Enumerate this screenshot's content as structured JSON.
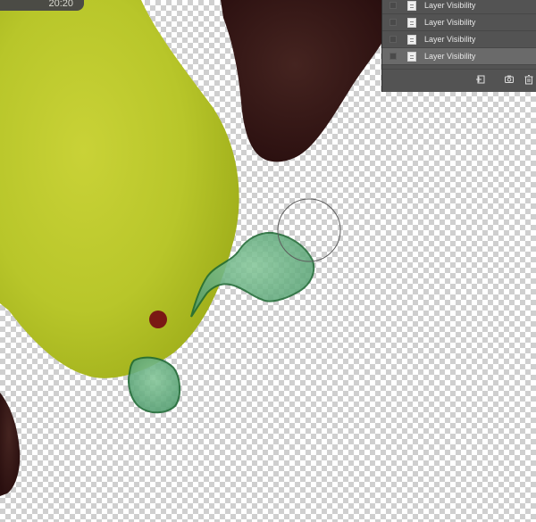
{
  "top_pill": {
    "text": "20:20"
  },
  "history_panel": {
    "rows": [
      {
        "label": "Layer Visibility"
      },
      {
        "label": "Layer Visibility"
      },
      {
        "label": "Layer Visibility"
      },
      {
        "label": "Layer Visibility"
      }
    ],
    "selected_index": 3,
    "footer_icons": [
      "new-snapshot-icon",
      "camera-icon",
      "trash-icon"
    ]
  },
  "colors": {
    "transparency_check_light": "#ffffff",
    "transparency_check_dark": "#cfcfcf",
    "yellow_shape": "#b8c62a",
    "dark_shape": "#3a1a18",
    "green_shape": "#5aa77b",
    "green_outline": "#1f6a35",
    "red_dot": "#7a1914",
    "panel_bg": "#535353",
    "selected_row_bg": "#6a6a6a"
  }
}
